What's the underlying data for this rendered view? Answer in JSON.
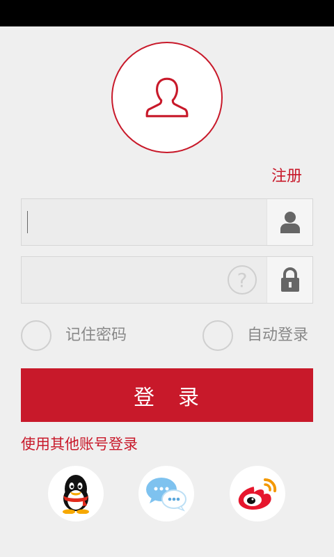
{
  "header": {
    "register_label": "注册"
  },
  "form": {
    "username_value": "",
    "password_value": "",
    "help_label": "?",
    "remember_label": "记住密码",
    "auto_login_label": "自动登录",
    "login_label": "登　录"
  },
  "social": {
    "title": "使用其他账号登录",
    "icons": [
      "qq-icon",
      "wechat-icon",
      "weibo-icon"
    ]
  },
  "colors": {
    "accent": "#c8192a",
    "background": "#efefef",
    "status_bar": "#000000"
  }
}
